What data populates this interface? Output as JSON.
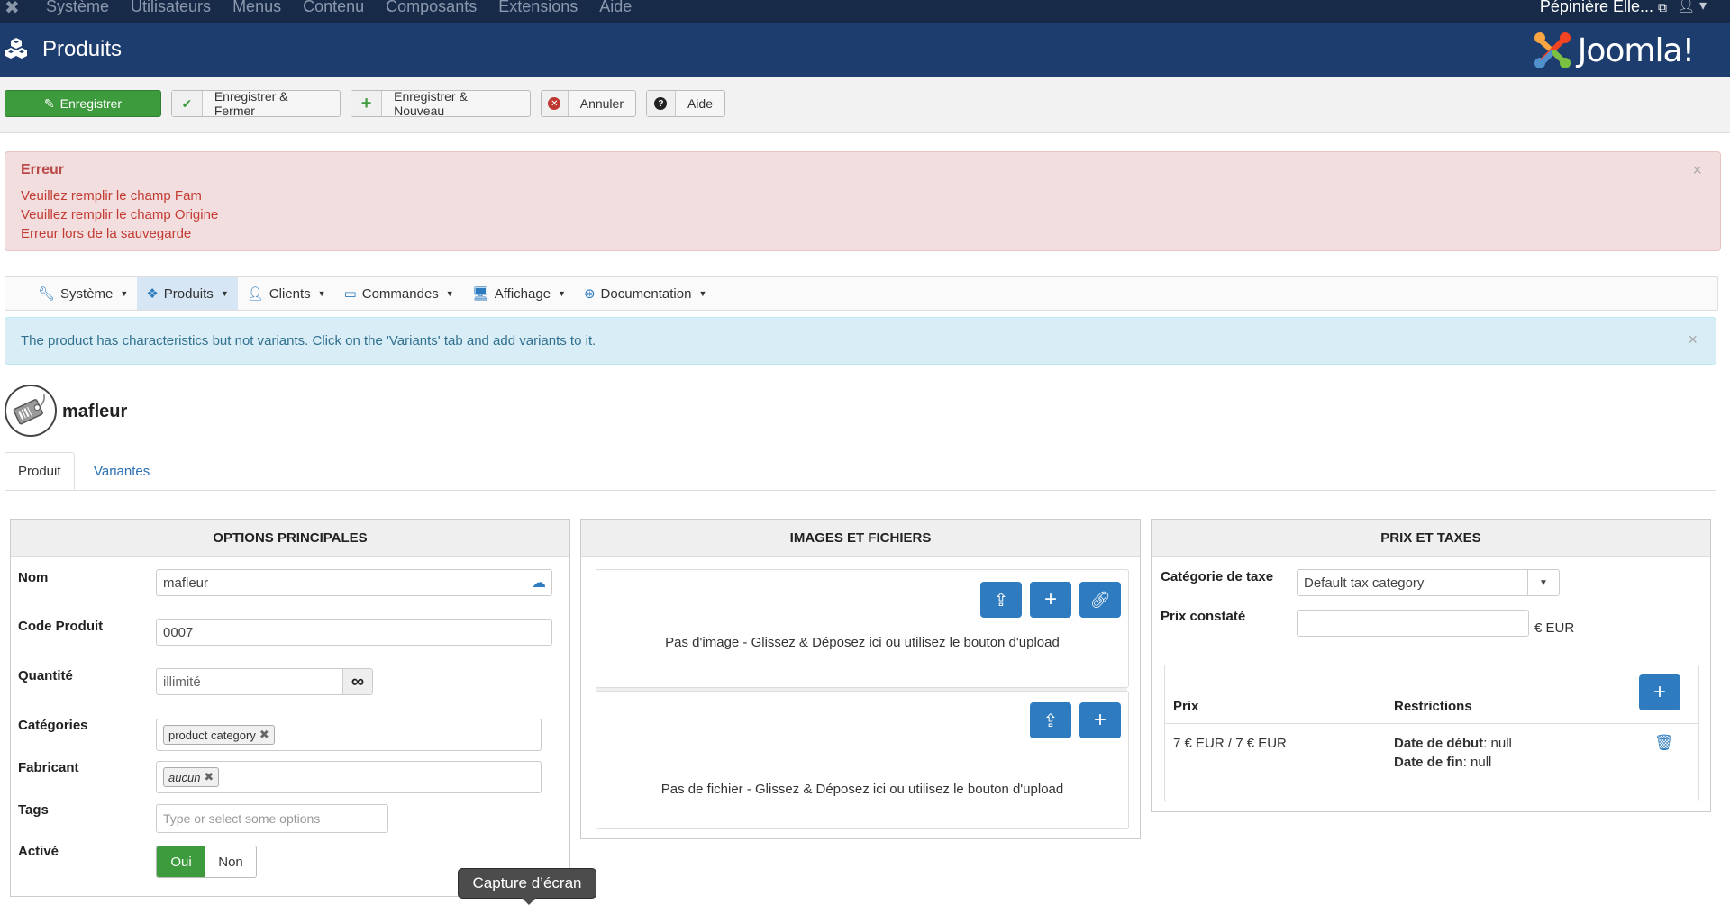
{
  "topnav": {
    "items": [
      "Système",
      "Utilisateurs",
      "Menus",
      "Contenu",
      "Composants",
      "Extensions",
      "Aide"
    ],
    "site_name": "Pépinière Elle...",
    "user_icon": "user-icon"
  },
  "titlebar": {
    "title": "Produits",
    "brand": "Joomla!"
  },
  "toolbar": {
    "save_label": "Enregistrer",
    "save_close_label": "Enregistrer & Fermer",
    "save_new_label": "Enregistrer & Nouveau",
    "cancel_label": "Annuler",
    "help_label": "Aide"
  },
  "error_alert": {
    "title": "Erreur",
    "messages": [
      "Veuillez remplir le champ Fam",
      "Veuillez remplir le champ Origine",
      "Erreur lors de la sauvegarde"
    ]
  },
  "subnav": {
    "items": [
      {
        "label": "Système",
        "icon": "wrench-icon"
      },
      {
        "label": "Produits",
        "icon": "cubes-icon"
      },
      {
        "label": "Clients",
        "icon": "user-icon"
      },
      {
        "label": "Commandes",
        "icon": "credit-card-icon"
      },
      {
        "label": "Affichage",
        "icon": "monitor-icon"
      },
      {
        "label": "Documentation",
        "icon": "lifebuoy-icon"
      }
    ]
  },
  "info_alert": {
    "message": "The product has characteristics but not variants. Click on the 'Variants' tab and add variants to it."
  },
  "product": {
    "name": "mafleur"
  },
  "tabs": {
    "product": "Produit",
    "variants": "Variantes"
  },
  "options_panel": {
    "title": "OPTIONS PRINCIPALES",
    "name_label": "Nom",
    "name_value": "mafleur",
    "code_label": "Code Produit",
    "code_value": "0007",
    "qty_label": "Quantité",
    "qty_value": "illimité",
    "categories_label": "Catégories",
    "category_chip": "product category",
    "manufacturer_label": "Fabricant",
    "manufacturer_chip": "aucun",
    "tags_label": "Tags",
    "tags_placeholder": "Type or select some options",
    "active_label": "Activé",
    "yes": "Oui",
    "no": "Non"
  },
  "images_panel": {
    "title": "IMAGES ET FICHIERS",
    "no_image": "Pas d'image - Glissez & Déposez ici ou utilisez le bouton d'upload",
    "no_file": "Pas de fichier - Glissez & Déposez ici ou utilisez le bouton d'upload"
  },
  "price_panel": {
    "title": "PRIX ET TAXES",
    "tax_category_label": "Catégorie de taxe",
    "tax_category_value": "Default tax category",
    "listed_price_label": "Prix constaté",
    "currency": "€ EUR",
    "col_price": "Prix",
    "col_restrictions": "Restrictions",
    "price_value": "7 € EUR / 7 € EUR",
    "start_label": "Date de début",
    "start_value": ": null",
    "end_label": "Date de fin",
    "end_value": ": null"
  },
  "tooltip": {
    "text": "Capture d’écran"
  },
  "colors": {
    "topnav": "#172a48",
    "titlebar": "#1c3d6e",
    "save_green": "#3d9b3d",
    "blue_button": "#2e7bbf",
    "error_bg": "#f2dede",
    "info_bg": "#d9edf7"
  }
}
